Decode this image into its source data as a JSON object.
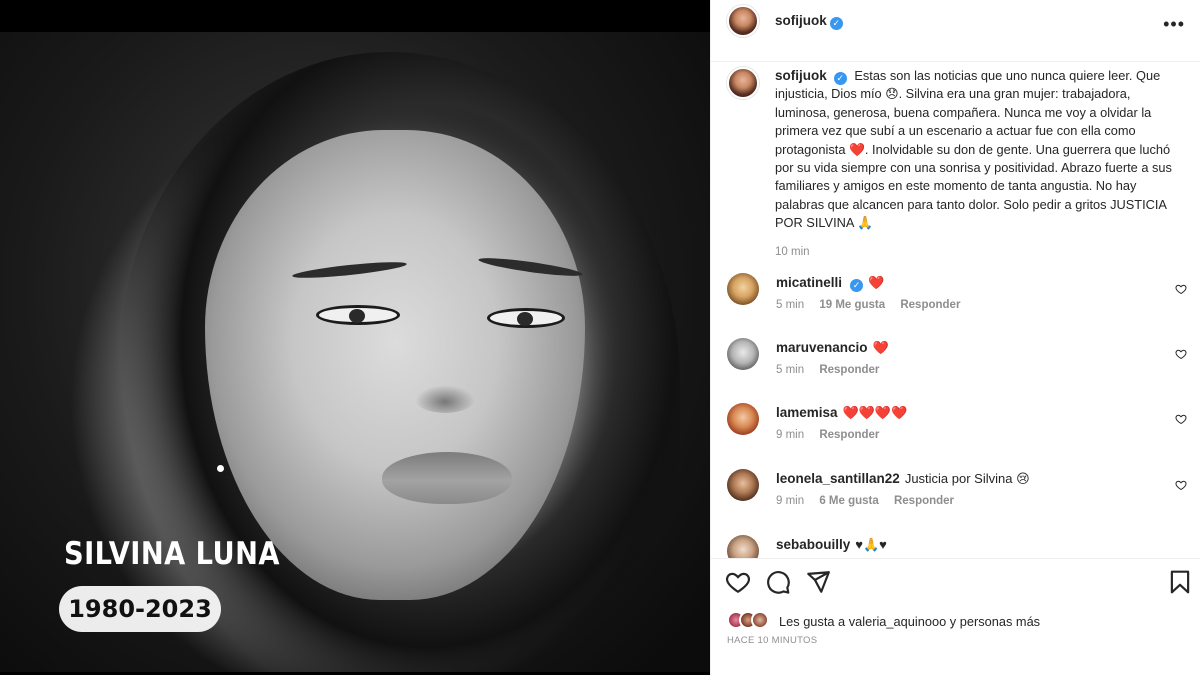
{
  "photo": {
    "name_overlay": "SILVINA LUNA",
    "years_overlay": "1980-2023"
  },
  "post": {
    "username": "sofijuok",
    "verified": true,
    "more_icon": "more-horizontal-icon",
    "caption_text": "Estas son las noticias que uno nunca quiere leer. Que injusticia, Dios mío 😞. Silvina era una gran mujer: trabajadora, luminosa, generosa, buena compañera. Nunca me voy a olvidar la primera vez que subí a un escenario a actuar fue con ella como protagonista ❤️. Inolvidable su don de gente. Una guerrera que luchó por su vida siempre con una sonrisa y positividad. Abrazo fuerte a sus familiares y amigos en este momento de tanta angustia. No hay palabras que alcancen para tanto dolor. Solo pedir a gritos JUSTICIA POR SILVINA 🙏",
    "caption_time": "10 min"
  },
  "comments": [
    {
      "username": "micatinelli",
      "verified": true,
      "text": "❤️",
      "time": "5 min",
      "likes": "19 Me gusta",
      "reply": "Responder"
    },
    {
      "username": "maruvenancio",
      "verified": false,
      "text": "❤️",
      "time": "5 min",
      "likes": "",
      "reply": "Responder"
    },
    {
      "username": "lamemisa",
      "verified": false,
      "text": "❤️❤️❤️❤️",
      "time": "9 min",
      "likes": "",
      "reply": "Responder"
    },
    {
      "username": "leonela_santillan22",
      "verified": false,
      "text": "Justicia por Silvina 😢",
      "time": "9 min",
      "likes": "6 Me gusta",
      "reply": "Responder"
    },
    {
      "username": "sebabouilly",
      "verified": false,
      "text": "♥🙏♥",
      "time": "",
      "likes": "",
      "reply": ""
    }
  ],
  "actions": {
    "icons": [
      "heart-icon",
      "comment-icon",
      "share-icon",
      "bookmark-icon"
    ]
  },
  "likes": {
    "text": "Les gusta a valeria_aquinooo y personas más"
  },
  "timestamp": "HACE 10 MINUTOS",
  "colors": {
    "verified_blue": "#3897f0",
    "heart_red": "#ed2b35",
    "muted_text": "#8e8e8e",
    "text": "#262626"
  }
}
